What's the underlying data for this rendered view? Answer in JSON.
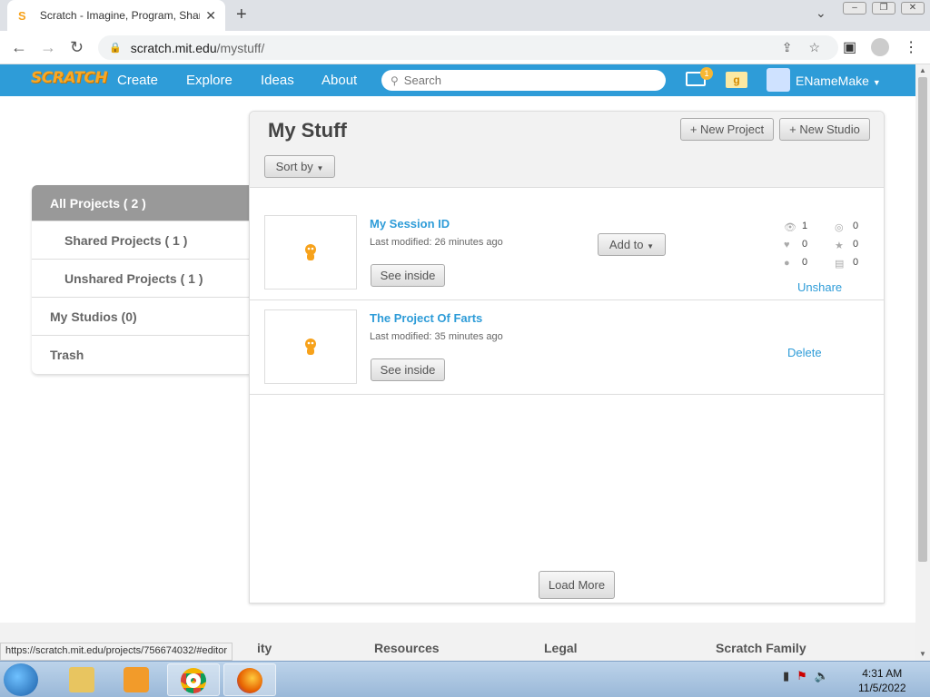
{
  "browser": {
    "tab_title": "Scratch - Imagine, Program, Share",
    "close_glyph": "✕",
    "newtab_glyph": "+",
    "url_host": "scratch.mit.edu",
    "url_path": "/mystuff/",
    "status_url": "https://scratch.mit.edu/projects/756674032/#editor"
  },
  "scratch_nav": {
    "logo": "SCRATCH",
    "links": [
      "Create",
      "Explore",
      "Ideas",
      "About"
    ],
    "search_placeholder": "Search",
    "message_count": "1",
    "mystuff_glyph": "g",
    "username": "ENameMake"
  },
  "page": {
    "title": "My Stuff",
    "new_project": "+ New Project",
    "new_studio": "+ New Studio",
    "sort_by": "Sort by"
  },
  "sidebar": {
    "items": [
      {
        "label": "All Projects ( 2 )"
      },
      {
        "label": "Shared Projects ( 1 )"
      },
      {
        "label": "Unshared Projects ( 1 )"
      },
      {
        "label": "My Studios (0)"
      },
      {
        "label": "Trash"
      }
    ]
  },
  "projects": [
    {
      "title": "My Session ID",
      "modified": "Last modified: 26 minutes ago",
      "see_inside": "See inside",
      "add_to": "Add to",
      "stats": {
        "views": "1",
        "remixes": "0",
        "loves": "0",
        "favorites": "0",
        "comments": "0",
        "studios": "0"
      },
      "action": "Unshare"
    },
    {
      "title": "The Project Of Farts",
      "modified": "Last modified: 35 minutes ago",
      "see_inside": "See inside",
      "action": "Delete"
    }
  ],
  "load_more": "Load More",
  "footer": {
    "columns": [
      "ity",
      "Resources",
      "Legal",
      "Scratch Family"
    ]
  },
  "taskbar": {
    "time": "4:31 AM",
    "date": "11/5/2022"
  },
  "colors": {
    "scratch_blue": "#2e9cd8",
    "sidebar_active": "#999999"
  }
}
